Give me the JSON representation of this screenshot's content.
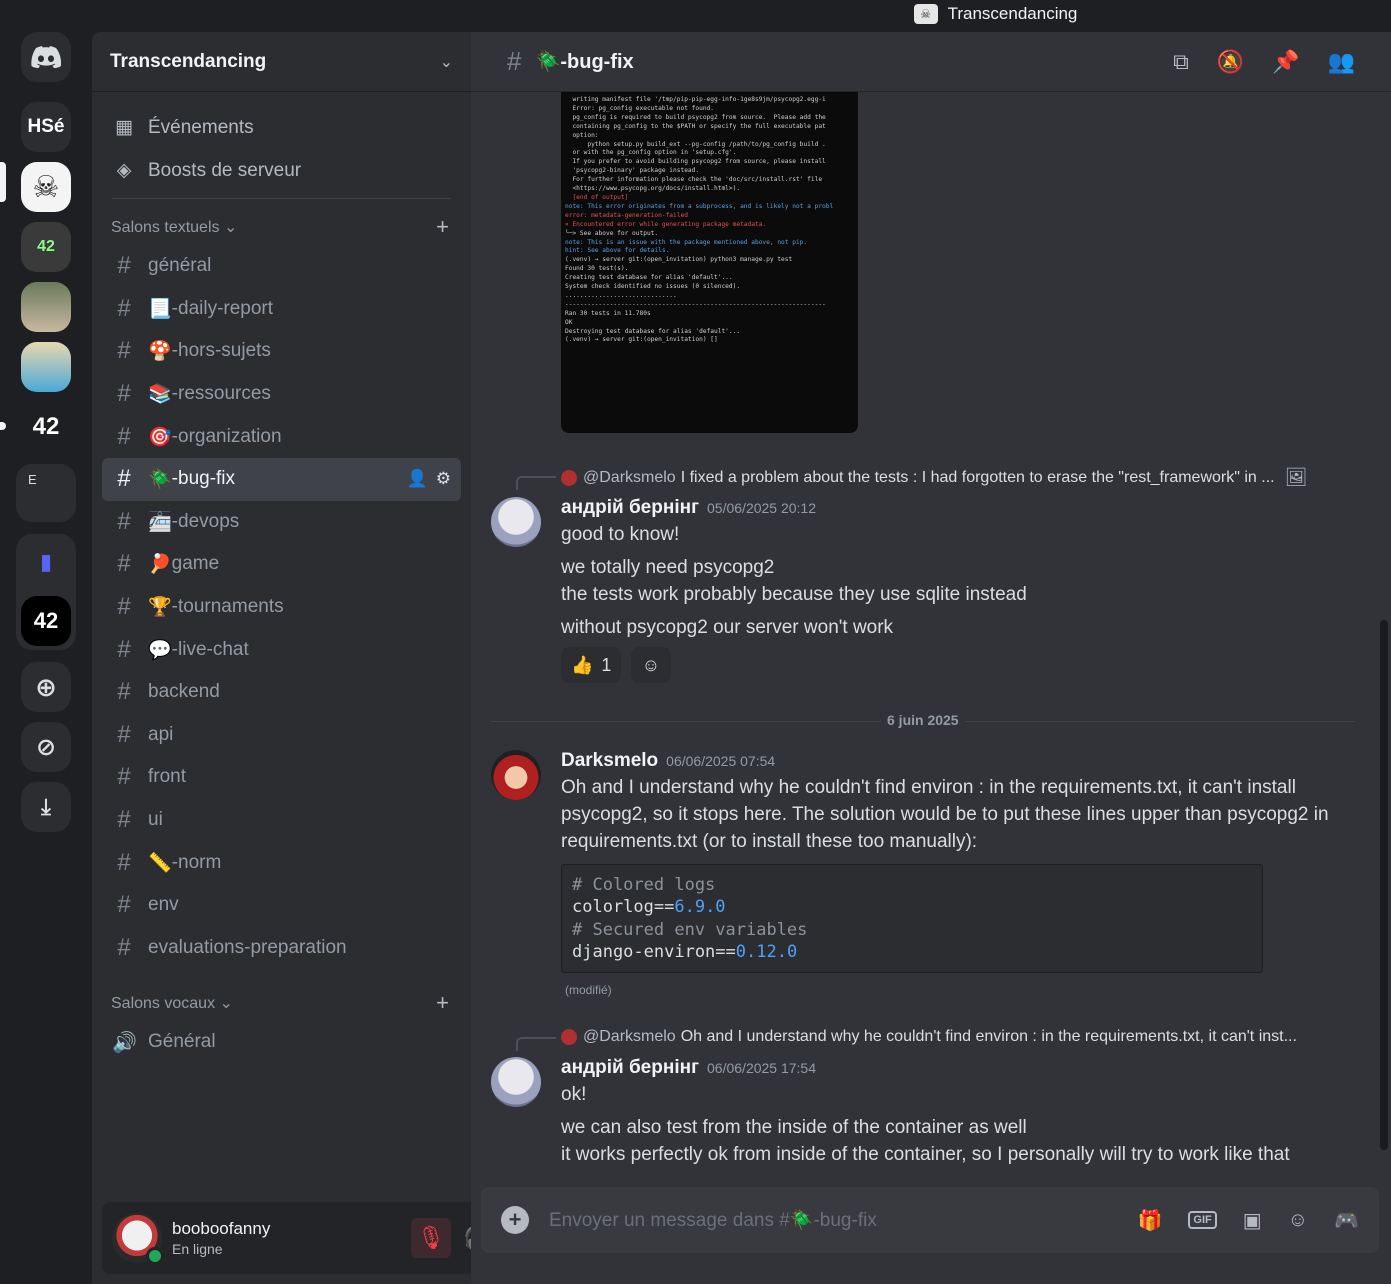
{
  "window": {
    "title": "Transcendancing"
  },
  "rail": {
    "servers": [
      {
        "label": "HSé"
      },
      {
        "label": "E"
      }
    ]
  },
  "guild": {
    "name": "Transcendancing"
  },
  "sidebar_top": [
    {
      "icon": "calendar-icon",
      "label": "Événements"
    },
    {
      "icon": "boost-icon",
      "label": "Boosts de serveur"
    }
  ],
  "text_category": "Salons textuels",
  "channels": [
    {
      "emoji": "",
      "label": "général"
    },
    {
      "emoji": "📃",
      "label": "-daily-report"
    },
    {
      "emoji": "🍄",
      "label": "-hors-sujets"
    },
    {
      "emoji": "📚",
      "label": "-ressources"
    },
    {
      "emoji": "🎯",
      "label": "-organization"
    },
    {
      "emoji": "🪲",
      "label": "-bug-fix"
    },
    {
      "emoji": "🚈",
      "label": "-devops"
    },
    {
      "emoji": "🏓",
      "label": "game"
    },
    {
      "emoji": "🏆",
      "label": "-tournaments"
    },
    {
      "emoji": "💬",
      "label": "-live-chat"
    },
    {
      "emoji": "",
      "label": "backend"
    },
    {
      "emoji": "",
      "label": "api"
    },
    {
      "emoji": "",
      "label": "front"
    },
    {
      "emoji": "",
      "label": "ui"
    },
    {
      "emoji": "📏",
      "label": "-norm"
    },
    {
      "emoji": "",
      "label": "env"
    },
    {
      "emoji": "",
      "label": "evaluations-preparation"
    }
  ],
  "voice_category": "Salons vocaux",
  "voice_channels": [
    {
      "label": "Général"
    }
  ],
  "user": {
    "name": "booboofanny",
    "status": "En ligne"
  },
  "channel_header": {
    "name": "🪲-bug-fix"
  },
  "terminal_lines": [
    "  writing manifest file '/tmp/pip-pip-egg-info-1ge8s9jm/psycopg2.egg-i",
    "",
    "  Error: pg_config executable not found.",
    "",
    "  pg_config is required to build psycopg2 from source.  Please add the",
    "  containing pg_config to the $PATH or specify the full executable pat",
    "  option:",
    "",
    "      python setup.py build_ext --pg-config /path/to/pg_config build .",
    "",
    "  or with the pg_config option in 'setup.cfg'.",
    "",
    "  If you prefer to avoid building psycopg2 from source, please install",
    "  'psycopg2-binary' package instead.",
    "",
    "  For further information please check the 'doc/src/install.rst' file",
    "  <https://www.psycopg.org/docs/install.html>).",
    "",
    "  [end of output]",
    "",
    "note: This error originates from a subprocess, and is likely not a probl",
    "error: metadata-generation-failed",
    "",
    "× Encountered error while generating package metadata.",
    "╰─> See above for output.",
    "",
    "note: This is an issue with the package mentioned above, not pip.",
    "hint: See above for details.",
    "(.venv) → server git:(open_invitation) python3 manage.py test",
    "Found 30 test(s).",
    "Creating test database for alias 'default'...",
    "System check identified no issues (0 silenced).",
    "..............................",
    "----------------------------------------------------------------------",
    "Ran 30 tests in 11.780s",
    "",
    "OK",
    "Destroying test database for alias 'default'...",
    "(.venv) → server git:(open_invitation) []"
  ],
  "messages": [
    {
      "reply_name": "@Darksmelo",
      "reply_text": "I fixed a problem about the tests : I had forgotten to erase the \"rest_framework\" in ...",
      "author": "андрій бернінг",
      "timestamp": "05/06/2025 20:12",
      "lines": [
        "good to know!",
        "we totally need psycopg2",
        "the tests work probably because they use sqlite instead",
        "without psycopg2 our server won't work"
      ],
      "reaction": {
        "emoji": "👍",
        "count": "1"
      }
    },
    {
      "author": "Darksmelo",
      "timestamp": "06/06/2025 07:54",
      "lines": [
        "Oh and I understand why he couldn't find environ : in the requirements.txt, it can't install",
        "psycopg2, so it stops here. The solution would be to put these lines upper than psycopg2 in",
        "requirements.txt (or to install these too manually):"
      ],
      "code": {
        "c1": "# Colored logs",
        "l2a": "colorlog==",
        "l2b": "6.9.0",
        "c3": "# Secured env variables",
        "l4a": "django-environ==",
        "l4b": "0.12.0"
      },
      "edited": "(modifié)"
    },
    {
      "reply_name": "@Darksmelo",
      "reply_text": "Oh and I understand why he couldn't find environ : in the requirements.txt, it can't inst...",
      "author": "андрій бернінг",
      "timestamp": "06/06/2025 17:54",
      "lines": [
        "ok!",
        "we can also test from the inside of the container as well",
        "it works perfectly ok from inside of the container, so I personally will try to work like that"
      ]
    }
  ],
  "date_divider": "6 juin 2025",
  "composer": {
    "placeholder": "Envoyer un message dans #🪲-bug-fix",
    "gif": "GIF"
  },
  "colors": {
    "accent": "#5865f2",
    "online": "#23a55a",
    "muted": "#f23f43"
  }
}
